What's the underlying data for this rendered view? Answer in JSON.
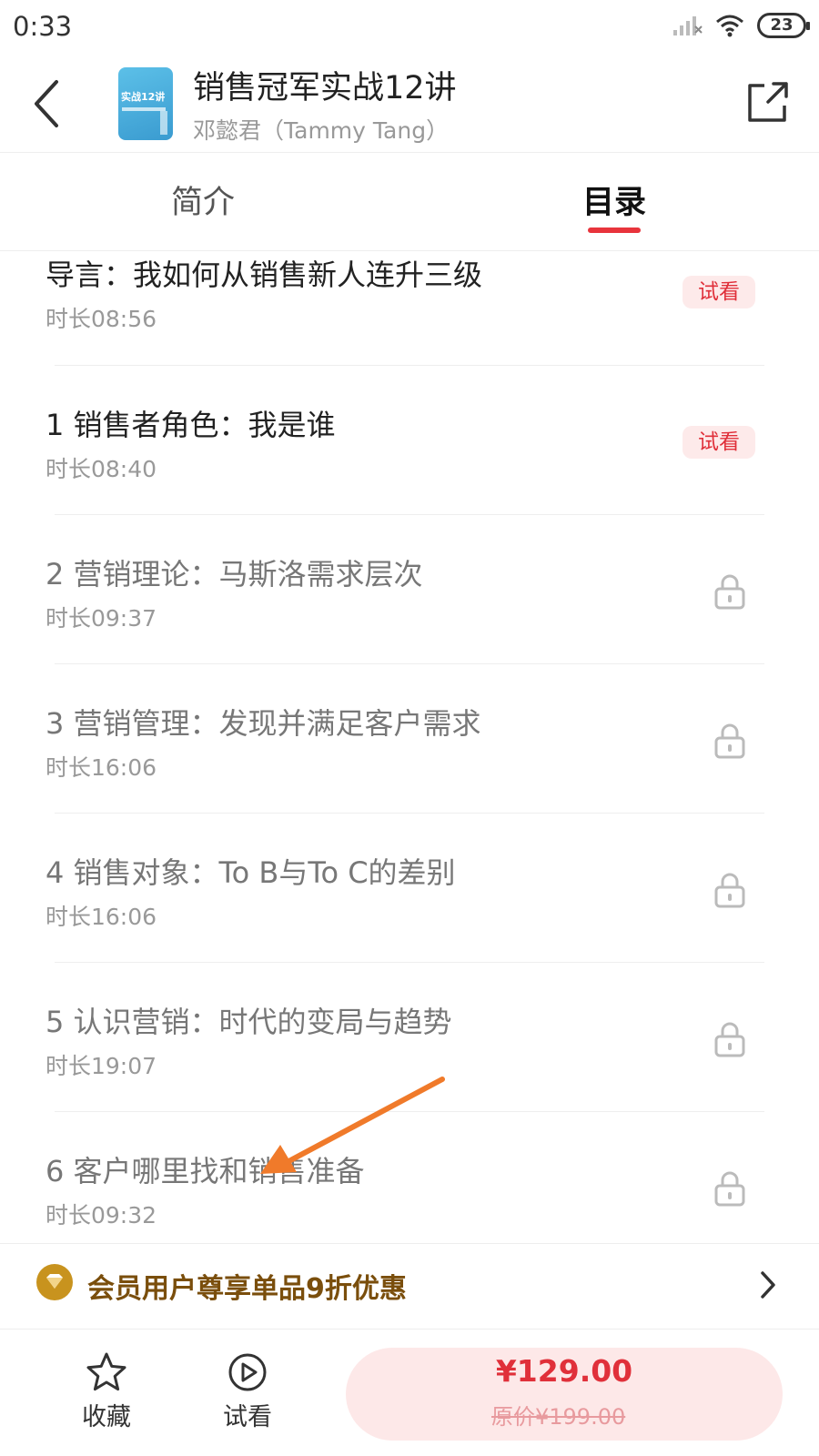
{
  "status_bar": {
    "time": "0:33",
    "battery": "23"
  },
  "header": {
    "cover_text": "实战12讲",
    "title": "销售冠军实战12讲",
    "author": "邓懿君（Tammy Tang）"
  },
  "tabs": [
    {
      "label": "简介",
      "active": false
    },
    {
      "label": "目录",
      "active": true
    }
  ],
  "accent_color": "#e8343c",
  "lessons": [
    {
      "title": "导言：我如何从销售新人连升三级",
      "duration": "时长08:56",
      "badge": "试看",
      "locked": false
    },
    {
      "title": "1 销售者角色：我是谁",
      "duration": "时长08:40",
      "badge": "试看",
      "locked": false
    },
    {
      "title": "2 营销理论：马斯洛需求层次",
      "duration": "时长09:37",
      "locked": true
    },
    {
      "title": "3 营销管理：发现并满足客户需求",
      "duration": "时长16:06",
      "locked": true
    },
    {
      "title": "4 销售对象：To B与To C的差别",
      "duration": "时长16:06",
      "locked": true
    },
    {
      "title": "5 认识营销：时代的变局与趋势",
      "duration": "时长19:07",
      "locked": true
    },
    {
      "title": "6 客户哪里找和销售准备",
      "duration": "时长09:32",
      "locked": true
    }
  ],
  "member_banner": {
    "text": "会员用户尊享单品9折优惠"
  },
  "bottom_bar": {
    "favorite_label": "收藏",
    "trial_label": "试看",
    "price": "¥129.00",
    "original_price": "原价¥199.00"
  }
}
